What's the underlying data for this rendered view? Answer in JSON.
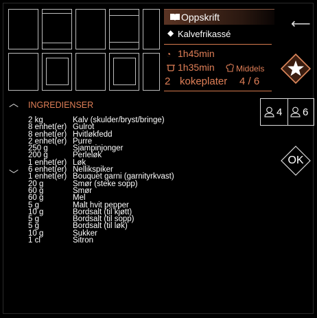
{
  "header": {
    "tab_label": "Oppskrift",
    "recipe_name": "Kalvefrikassé"
  },
  "info": {
    "total_time": "1h45min",
    "cook_time": "1h35min",
    "difficulty": "Middels",
    "plates": "2",
    "plates_label": "kokeplater",
    "step": "4 / 6"
  },
  "ingredients": {
    "title": "INGREDIENSER",
    "items": [
      {
        "qty": "2 kg",
        "name": "Kalv (skulder/bryst/bringe)"
      },
      {
        "qty": "8 enhet(er)",
        "name": "Gulrot"
      },
      {
        "qty": "8 enhet(er)",
        "name": "Hvitløkfedd"
      },
      {
        "qty": "2 enhet(er)",
        "name": "Purre"
      },
      {
        "qty": "250 g",
        "name": "Sjampinjonger"
      },
      {
        "qty": "200 g",
        "name": "Perleløk"
      },
      {
        "qty": "1 enhet(er)",
        "name": "Løk"
      },
      {
        "qty": "6 enhet(er)",
        "name": "Nellikspiker"
      },
      {
        "qty": "1 enhet(er)",
        "name": "Bouquet garni (garnityrkvast)"
      },
      {
        "qty": "20 g",
        "name": "Smør (steke sopp)"
      },
      {
        "qty": "60 g",
        "name": "Smør"
      },
      {
        "qty": "60 g",
        "name": "Mel"
      },
      {
        "qty": "5 g",
        "name": "Malt hvit pepper"
      },
      {
        "qty": "10 g",
        "name": "Bordsalt (til kjøtt)"
      },
      {
        "qty": "5 g",
        "name": "Bordsalt (til sopp)"
      },
      {
        "qty": "5 g",
        "name": "Bordsalt (til løk)"
      },
      {
        "qty": "10 g",
        "name": "Sukker"
      },
      {
        "qty": "1 cl",
        "name": "Sitron"
      }
    ]
  },
  "servings": {
    "option_a": "4",
    "option_b": "6"
  },
  "ok_label": "OK",
  "colors": {
    "accent": "#d77a4e",
    "background": "#000000"
  }
}
